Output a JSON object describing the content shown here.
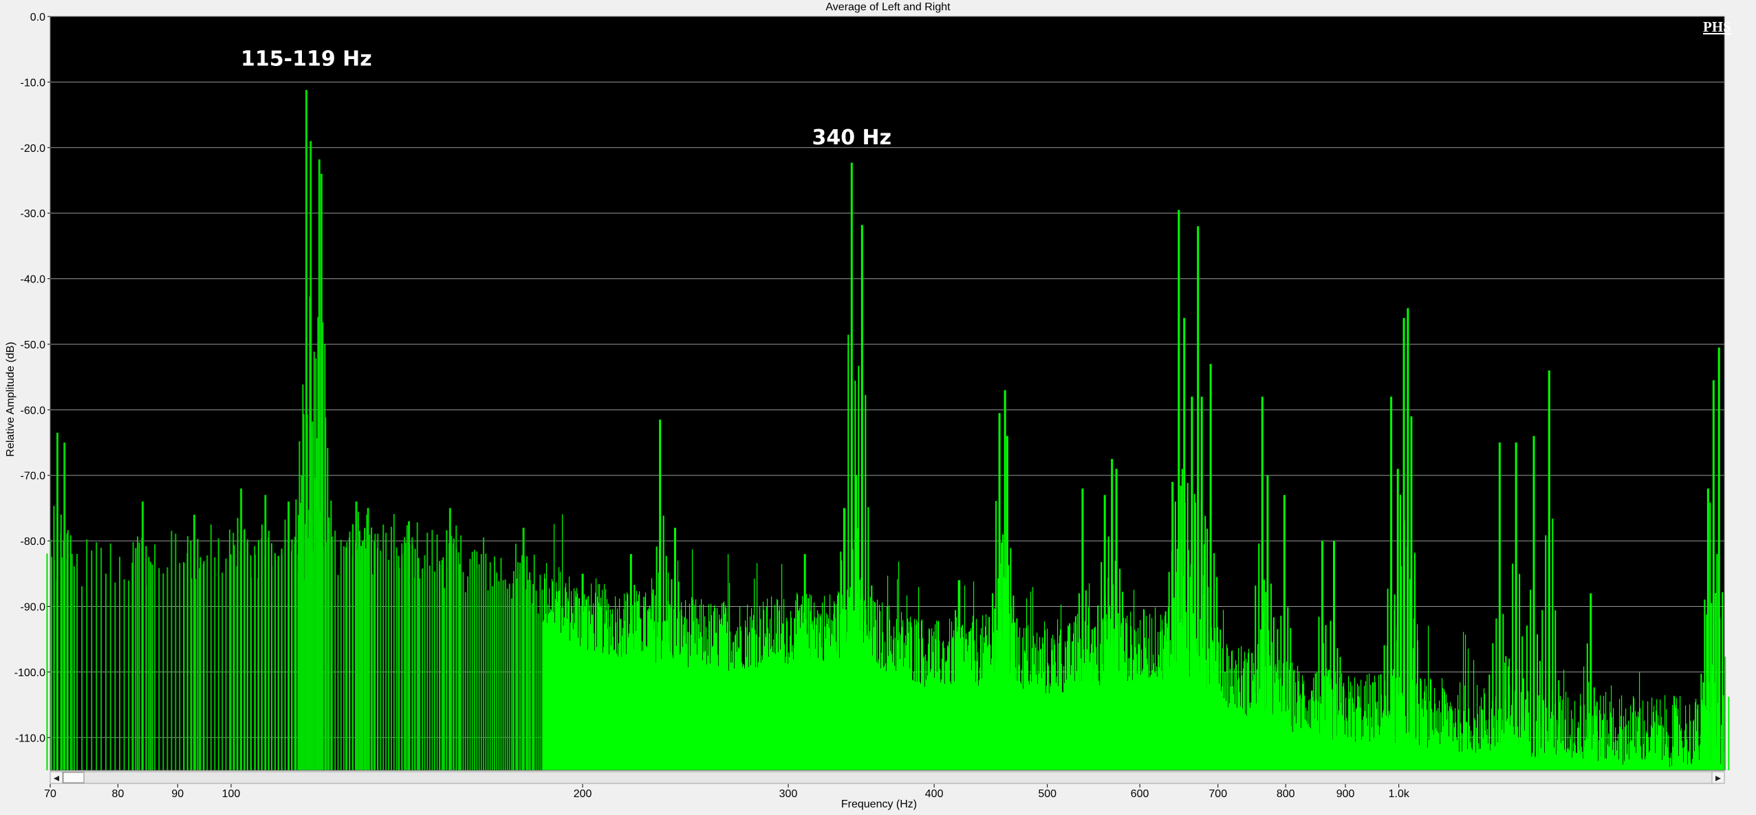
{
  "chart_data": {
    "type": "area",
    "title": "Average of Left and Right",
    "xlabel": "Frequency (Hz)",
    "ylabel": "Relative Amplitude (dB)",
    "x_scale": "log",
    "xlim": [
      70,
      1900
    ],
    "ylim": [
      -115,
      0
    ],
    "grid": true,
    "y_ticks": [
      "0.0",
      "-10.0",
      "-20.0",
      "-30.0",
      "-40.0",
      "-50.0",
      "-60.0",
      "-70.0",
      "-80.0",
      "-90.0",
      "-100.0",
      "-110.0"
    ],
    "x_ticks": [
      {
        "value": 70,
        "label": "70"
      },
      {
        "value": 80,
        "label": "80"
      },
      {
        "value": 90,
        "label": "90"
      },
      {
        "value": 100,
        "label": "100"
      },
      {
        "value": 200,
        "label": "200"
      },
      {
        "value": 300,
        "label": "300"
      },
      {
        "value": 400,
        "label": "400"
      },
      {
        "value": 500,
        "label": "500"
      },
      {
        "value": 600,
        "label": "600"
      },
      {
        "value": 700,
        "label": "700"
      },
      {
        "value": 800,
        "label": "800"
      },
      {
        "value": 900,
        "label": "900"
      },
      {
        "value": 1000,
        "label": "1.0k"
      }
    ],
    "annotations": [
      {
        "text": "115-119 Hz",
        "x": 116,
        "y": -7.5
      },
      {
        "text": "340 Hz",
        "x": 340,
        "y": -19.5
      }
    ],
    "series": [
      {
        "floor": [
          [
            70,
            -86
          ],
          [
            100,
            -84
          ],
          [
            130,
            -82
          ],
          [
            160,
            -85
          ],
          [
            190,
            -89
          ],
          [
            200,
            -92
          ],
          [
            260,
            -95
          ],
          [
            300,
            -94
          ],
          [
            340,
            -93
          ],
          [
            400,
            -98
          ],
          [
            450,
            -97
          ],
          [
            500,
            -99
          ],
          [
            560,
            -97
          ],
          [
            620,
            -96
          ],
          [
            680,
            -97
          ],
          [
            720,
            -101
          ],
          [
            800,
            -104
          ],
          [
            900,
            -106
          ],
          [
            1000,
            -106
          ],
          [
            1200,
            -108
          ],
          [
            1500,
            -109
          ],
          [
            1900,
            -110
          ]
        ],
        "peaks": [
          {
            "x": 71,
            "y": -63.5
          },
          {
            "x": 72,
            "y": -65
          },
          {
            "x": 84,
            "y": -74
          },
          {
            "x": 93,
            "y": -76
          },
          {
            "x": 102,
            "y": -72
          },
          {
            "x": 107,
            "y": -73
          },
          {
            "x": 112,
            "y": -74
          },
          {
            "x": 115,
            "y": -70
          },
          {
            "x": 116,
            "y": -11.2
          },
          {
            "x": 117,
            "y": -19
          },
          {
            "x": 119,
            "y": -21.8
          },
          {
            "x": 119.5,
            "y": -24
          },
          {
            "x": 128,
            "y": -74
          },
          {
            "x": 131,
            "y": -75
          },
          {
            "x": 142,
            "y": -77
          },
          {
            "x": 154,
            "y": -75
          },
          {
            "x": 178,
            "y": -78
          },
          {
            "x": 200,
            "y": -85
          },
          {
            "x": 220,
            "y": -82
          },
          {
            "x": 233,
            "y": -61.5
          },
          {
            "x": 240,
            "y": -78
          },
          {
            "x": 310,
            "y": -82
          },
          {
            "x": 335,
            "y": -75
          },
          {
            "x": 340,
            "y": -22.3
          },
          {
            "x": 347,
            "y": -31.8
          },
          {
            "x": 343,
            "y": -70
          },
          {
            "x": 420,
            "y": -86
          },
          {
            "x": 455,
            "y": -60.5
          },
          {
            "x": 460,
            "y": -57
          },
          {
            "x": 462,
            "y": -64
          },
          {
            "x": 536,
            "y": -72
          },
          {
            "x": 560,
            "y": -73
          },
          {
            "x": 568,
            "y": -67.5
          },
          {
            "x": 573,
            "y": -69
          },
          {
            "x": 640,
            "y": -71
          },
          {
            "x": 648,
            "y": -29.5
          },
          {
            "x": 655,
            "y": -46
          },
          {
            "x": 665,
            "y": -58
          },
          {
            "x": 673,
            "y": -32
          },
          {
            "x": 678,
            "y": -58
          },
          {
            "x": 690,
            "y": -53
          },
          {
            "x": 764,
            "y": -58
          },
          {
            "x": 772,
            "y": -70
          },
          {
            "x": 798,
            "y": -73
          },
          {
            "x": 860,
            "y": -80
          },
          {
            "x": 880,
            "y": -80
          },
          {
            "x": 985,
            "y": -58
          },
          {
            "x": 998,
            "y": -69
          },
          {
            "x": 1010,
            "y": -46
          },
          {
            "x": 1018,
            "y": -44.5
          },
          {
            "x": 1025,
            "y": -61
          },
          {
            "x": 1220,
            "y": -65
          },
          {
            "x": 1260,
            "y": -65
          },
          {
            "x": 1305,
            "y": -64
          },
          {
            "x": 1345,
            "y": -54
          },
          {
            "x": 1460,
            "y": -88
          },
          {
            "x": 1840,
            "y": -72
          },
          {
            "x": 1860,
            "y": -55.5
          },
          {
            "x": 1880,
            "y": -50.5
          }
        ]
      }
    ],
    "colors": {
      "plot_bg": "#000000",
      "fill": "#00ff00",
      "fill_dark": "#00c400",
      "grid": "#9a9a9a"
    }
  },
  "watermark": "PHS",
  "scroll": {
    "left_arrow": "◂",
    "right_arrow": "▸"
  }
}
